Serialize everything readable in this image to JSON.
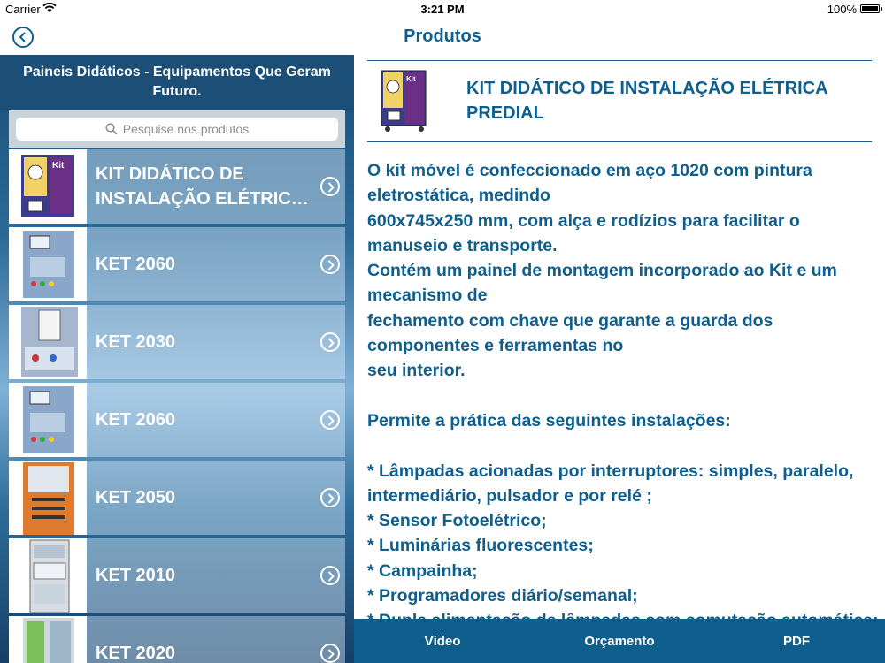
{
  "status": {
    "carrier": "Carrier",
    "time": "3:21 PM",
    "battery": "100%",
    "battery_level": 1.0
  },
  "nav": {
    "title": "Produtos"
  },
  "left": {
    "header": "Paineis Didáticos - Equipamentos Que Geram Futuro.",
    "search_placeholder": "Pesquise nos produtos",
    "items": [
      {
        "label": "KIT DIDÁTICO DE INSTALAÇÃO ELÉTRICA PREDIAL",
        "thumb": "kit"
      },
      {
        "label": "KET 2060",
        "thumb": "panel"
      },
      {
        "label": "KET 2030",
        "thumb": "display"
      },
      {
        "label": "KET 2060",
        "thumb": "panel"
      },
      {
        "label": "KET 2050",
        "thumb": "orange"
      },
      {
        "label": "KET 2010",
        "thumb": "rack"
      },
      {
        "label": "KET 2020",
        "thumb": "green"
      }
    ]
  },
  "product": {
    "title": "KIT DIDÁTICO DE INSTALAÇÃO ELÉTRICA PREDIAL",
    "description": "O kit móvel é confeccionado em aço 1020 com pintura eletrostática, medindo\n600x745x250 mm, com alça e rodízios para facilitar o manuseio e transporte.\nContém um painel de montagem incorporado ao Kit e um mecanismo de\nfechamento com chave que garante a guarda dos componentes e ferramentas no\nseu interior.\n\nPermite a prática das seguintes instalações:\n\n* Lâmpadas acionadas por interruptores: simples, paralelo, intermediário, pulsador e por relé ;\n* Sensor Fotoelétrico;\n* Luminárias fluorescentes;\n* Campainha;\n* Programadores diário/semanal;\n* Dupla alimentação de lâmpadas com comutação automática;"
  },
  "toolbar": {
    "video": "Vídeo",
    "orcamento": "Orçamento",
    "pdf": "PDF"
  },
  "colors": {
    "accent": "#0f5f8e",
    "header": "#1c4f78"
  },
  "icons": {
    "back": "chevron-left-circle-icon",
    "search": "search-icon",
    "item_chevron": "chevron-right-circle-icon"
  }
}
